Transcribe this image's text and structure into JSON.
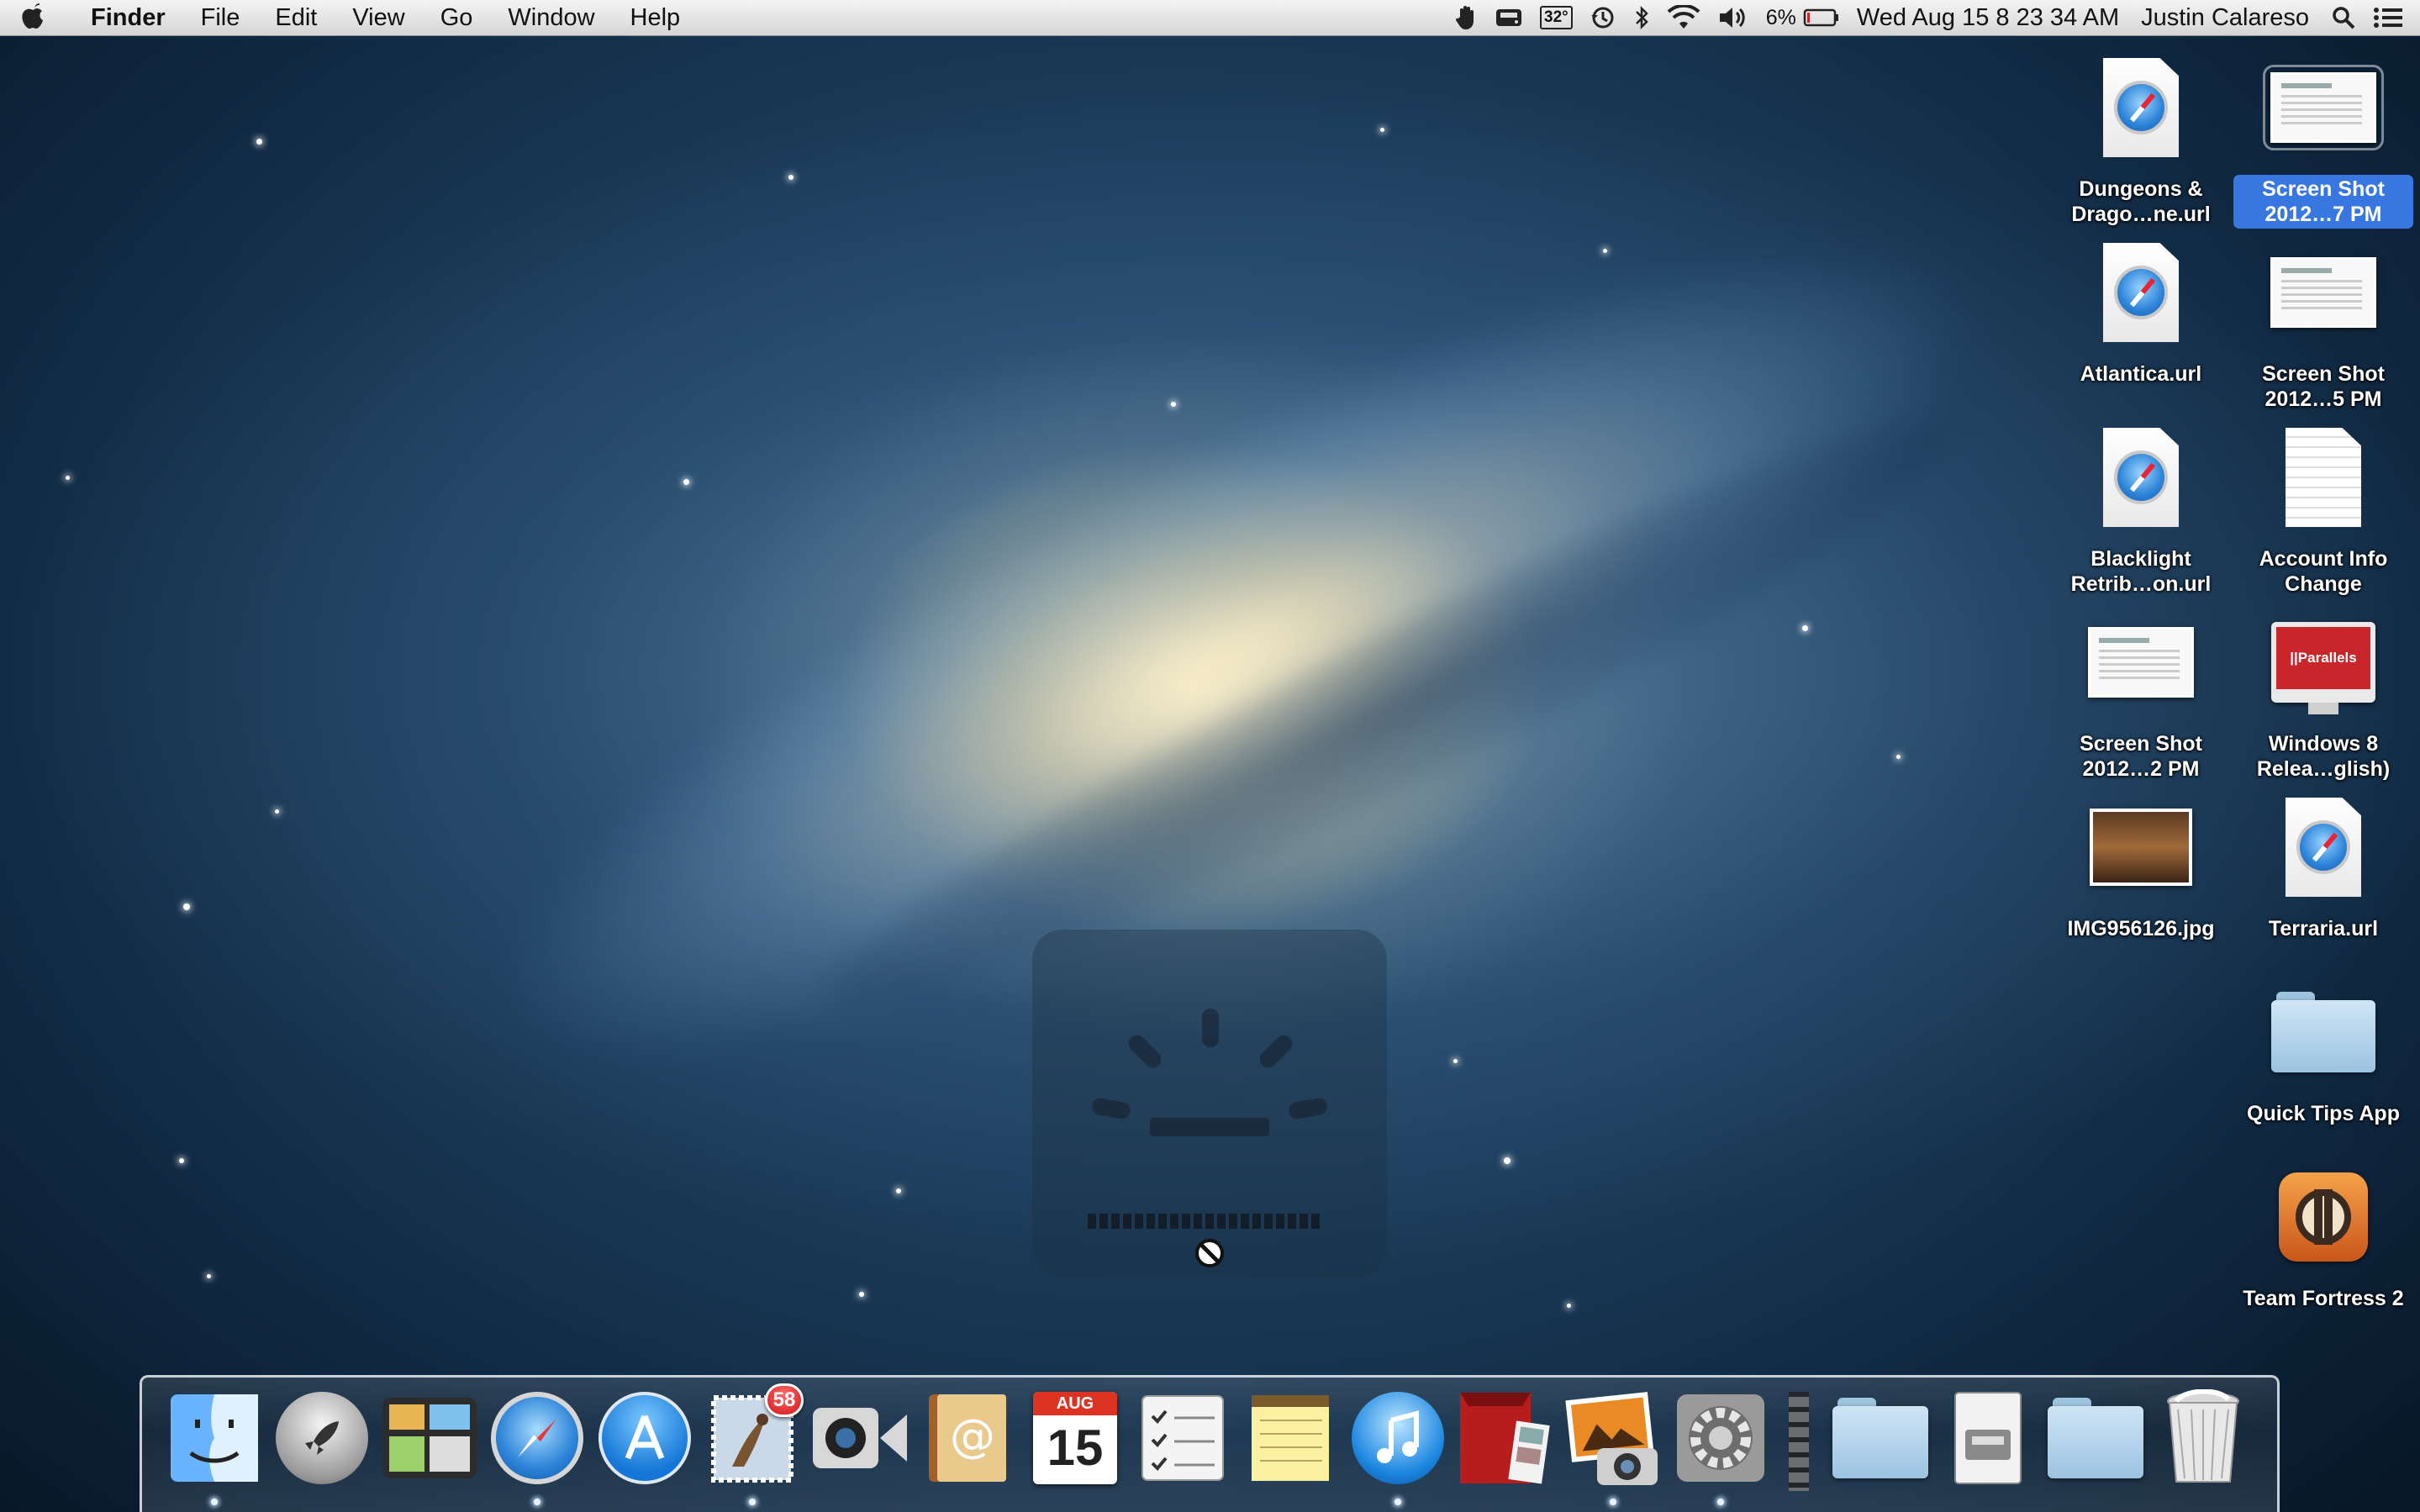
{
  "menubar": {
    "app_name": "Finder",
    "menus": [
      "File",
      "Edit",
      "View",
      "Go",
      "Window",
      "Help"
    ],
    "status": {
      "temperature": "32°",
      "battery_percent": "6%",
      "datetime": "Wed Aug 15  8 23 34 AM",
      "user": "Justin Calareso"
    },
    "icons": [
      "apple-icon",
      "hand-icon",
      "drive-icon",
      "temperature-icon",
      "time-machine-icon",
      "bluetooth-icon",
      "wifi-icon",
      "volume-icon",
      "battery-icon",
      "spotlight-icon",
      "notification-center-icon"
    ]
  },
  "desktop": {
    "icons": [
      {
        "label": "Dungeons & Drago…ne.url",
        "type": "url"
      },
      {
        "label": "Screen Shot 2012…7 PM",
        "type": "screenshot",
        "selected": true
      },
      {
        "label": "Atlantica.url",
        "type": "url"
      },
      {
        "label": "Screen Shot 2012…5 PM",
        "type": "screenshot"
      },
      {
        "label": "Blacklight Retrib…on.url",
        "type": "url"
      },
      {
        "label": "Account Info Change",
        "type": "document"
      },
      {
        "label": "Screen Shot 2012…2 PM",
        "type": "screenshot"
      },
      {
        "label": "Windows 8 Relea…glish)",
        "type": "parallels-vm",
        "badge_text": "||Parallels"
      },
      {
        "label": "IMG956126.jpg",
        "type": "photo"
      },
      {
        "label": "Terraria.url",
        "type": "url"
      },
      {
        "label": "Quick Tips App",
        "type": "folder"
      },
      {
        "label": "Team Fortress 2",
        "type": "app"
      }
    ]
  },
  "overlay": {
    "icon": "disk-activity-icon",
    "status_icon": "prohibited-icon"
  },
  "dock": {
    "items": [
      {
        "name": "finder",
        "running": true
      },
      {
        "name": "launchpad",
        "running": false
      },
      {
        "name": "mission-control",
        "running": false
      },
      {
        "name": "safari",
        "running": true
      },
      {
        "name": "app-store",
        "running": false
      },
      {
        "name": "mail",
        "running": true,
        "badge": "58"
      },
      {
        "name": "facetime",
        "running": false
      },
      {
        "name": "contacts",
        "running": false
      },
      {
        "name": "calendar",
        "running": false,
        "month": "AUG",
        "day": "15"
      },
      {
        "name": "reminders",
        "running": false
      },
      {
        "name": "notes",
        "running": false
      },
      {
        "name": "itunes",
        "running": true
      },
      {
        "name": "photo-booth",
        "running": false
      },
      {
        "name": "iphoto",
        "running": true
      },
      {
        "name": "system-preferences",
        "running": true
      },
      {
        "name": "applications-folder",
        "running": false
      },
      {
        "name": "drive-disk",
        "running": false
      },
      {
        "name": "windows-folder",
        "running": false
      },
      {
        "name": "trash",
        "running": false
      }
    ]
  },
  "colors": {
    "selection": "#3876e0",
    "badge": "#d1141a"
  }
}
